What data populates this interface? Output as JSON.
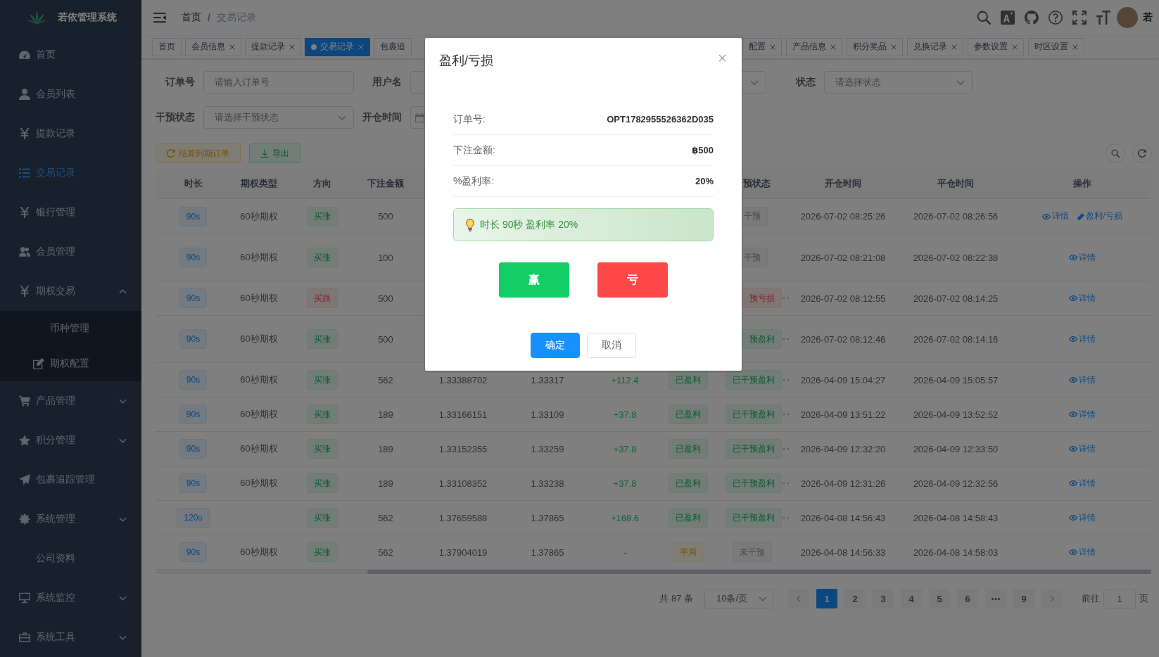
{
  "sidebar": {
    "title": "若依管理系统",
    "items": [
      {
        "label": "首页",
        "selected": false
      },
      {
        "label": "会员列表",
        "selected": false
      },
      {
        "label": "提款记录",
        "selected": false
      },
      {
        "label": "交易记录",
        "selected": true
      },
      {
        "label": "银行管理",
        "selected": false
      },
      {
        "label": "会员管理",
        "selected": false
      },
      {
        "label": "期权交易",
        "selected": false,
        "expanded": true,
        "children": [
          {
            "label": "币种管理",
            "selected": false
          },
          {
            "label": "期权配置",
            "selected": false
          }
        ]
      },
      {
        "label": "产品管理",
        "selected": false,
        "expanded": false
      },
      {
        "label": "积分管理",
        "selected": false,
        "expanded": false
      },
      {
        "label": "包裹追踪管理",
        "selected": false
      },
      {
        "label": "系统管理",
        "selected": false,
        "expanded": false
      },
      {
        "label": "公司资料",
        "selected": false
      },
      {
        "label": "系统监控",
        "selected": false,
        "expanded": false
      },
      {
        "label": "系统工具",
        "selected": false,
        "expanded": false
      }
    ]
  },
  "navbar": {
    "breadcrumb": {
      "items": [
        "首页",
        "交易记录"
      ],
      "separator": "/"
    },
    "user": "若"
  },
  "tabs": [
    {
      "label": "首页",
      "selected": false,
      "closable": false
    },
    {
      "label": "会员信息",
      "selected": false,
      "closable": true
    },
    {
      "label": "提款记录",
      "selected": false,
      "closable": true
    },
    {
      "label": "交易记录",
      "selected": true,
      "closable": true
    },
    {
      "label": "包裹追",
      "selected": false,
      "closable": false
    },
    {
      "label": "配置",
      "selected": false,
      "closable": true
    },
    {
      "label": "产品信息",
      "selected": false,
      "closable": true
    },
    {
      "label": "积分奖品",
      "selected": false,
      "closable": true
    },
    {
      "label": "兑换记录",
      "selected": false,
      "closable": true
    },
    {
      "label": "参数设置",
      "selected": false,
      "closable": true
    },
    {
      "label": "时区设置",
      "selected": false,
      "closable": true
    }
  ],
  "filters": [
    [
      {
        "label": "订单号",
        "kind": "input",
        "placeholder": "请输入订单号"
      },
      {
        "label": "用户名",
        "kind": "input"
      },
      {
        "kind": "select"
      },
      {
        "label": "状态",
        "kind": "select",
        "placeholder": "请选择状态"
      }
    ],
    [
      {
        "label": "干预状态",
        "kind": "select",
        "placeholder": "请选择干预状态"
      },
      {
        "label": "开仓时间",
        "kind": "date"
      }
    ]
  ],
  "toolbar": [
    {
      "label": "结算到期订单",
      "kind": "warning"
    },
    {
      "label": "导出",
      "kind": "success"
    }
  ],
  "table": {
    "header": {
      "duration": "时长",
      "option_type": "期权类型",
      "direction": "方向",
      "amount": "下注金额",
      "intervention": "预状态",
      "open_time": "开仓时间",
      "close_time": "平仓时间",
      "actions": "操作"
    },
    "rows": [
      {
        "duration": "90s",
        "option_type": "60秒期权",
        "direction": {
          "text": "买涨",
          "kind": "success"
        },
        "amount": "500",
        "intervention": {
          "text": "干预",
          "kind": "info",
          "truncated": false
        },
        "open_time": "2026-07-02 08:25:26",
        "close_time": "2026-07-02 08:26:56",
        "actions": [
          {
            "label": "详情",
            "kind": "view"
          },
          {
            "label": "盈利/亏损",
            "kind": "edit"
          }
        ]
      },
      {
        "duration": "90s",
        "option_type": "60秒期权",
        "direction": {
          "text": "买涨",
          "kind": "success"
        },
        "amount": "100",
        "intervention": {
          "text": "干预",
          "kind": "info",
          "truncated": false
        },
        "open_time": "2026-07-02 08:21:08",
        "close_time": "2026-07-02 08:22:38",
        "actions": [
          {
            "label": "详情",
            "kind": "view"
          }
        ]
      },
      {
        "duration": "90s",
        "option_type": "60秒期权",
        "direction": {
          "text": "买跌",
          "kind": "danger"
        },
        "amount": "500",
        "intervention": {
          "text": "预亏损",
          "kind": "danger",
          "truncated": true
        },
        "open_time": "2026-07-02 08:12:55",
        "close_time": "2026-07-02 08:14:25",
        "actions": [
          {
            "label": "详情",
            "kind": "view"
          }
        ]
      },
      {
        "duration": "90s",
        "option_type": "60秒期权",
        "direction": {
          "text": "买涨",
          "kind": "success"
        },
        "amount": "500",
        "intervention": {
          "text": "预盈利",
          "kind": "success",
          "truncated": true
        },
        "open_time": "2026-07-02 08:12:46",
        "close_time": "2026-07-02 08:14:16",
        "actions": [
          {
            "label": "详情",
            "kind": "view"
          }
        ]
      },
      {
        "duration": "90s",
        "option_type": "60秒期权",
        "direction": {
          "text": "买涨",
          "kind": "success"
        },
        "amount": "562",
        "column_5": "1.33388702",
        "column_6": "1.33317",
        "column_7": {
          "text": "+112.4",
          "kind": "gain"
        },
        "column_8": {
          "text": "已盈利",
          "kind": "success"
        },
        "intervention": {
          "text": "已干预盈利",
          "kind": "success",
          "truncated": true
        },
        "open_time": "2026-04-09 15:04:27",
        "close_time": "2026-04-09 15:05:57",
        "actions": [
          {
            "label": "详情",
            "kind": "view"
          }
        ]
      },
      {
        "duration": "90s",
        "option_type": "60秒期权",
        "direction": {
          "text": "买涨",
          "kind": "success"
        },
        "amount": "189",
        "column_5": "1.33166151",
        "column_6": "1.33109",
        "column_7": {
          "text": "+37.8",
          "kind": "gain"
        },
        "column_8": {
          "text": "已盈利",
          "kind": "success"
        },
        "intervention": {
          "text": "已干预盈利",
          "kind": "success",
          "truncated": true
        },
        "open_time": "2026-04-09 13:51:22",
        "close_time": "2026-04-09 13:52:52",
        "actions": [
          {
            "label": "详情",
            "kind": "view"
          }
        ]
      },
      {
        "duration": "90s",
        "option_type": "60秒期权",
        "direction": {
          "text": "买涨",
          "kind": "success"
        },
        "amount": "189",
        "column_5": "1.33152355",
        "column_6": "1.33259",
        "column_7": {
          "text": "+37.8",
          "kind": "gain"
        },
        "column_8": {
          "text": "已盈利",
          "kind": "success"
        },
        "intervention": {
          "text": "已干预盈利",
          "kind": "success",
          "truncated": true
        },
        "open_time": "2026-04-09 12:32:20",
        "close_time": "2026-04-09 12:33:50",
        "actions": [
          {
            "label": "详情",
            "kind": "view"
          }
        ]
      },
      {
        "duration": "90s",
        "option_type": "60秒期权",
        "direction": {
          "text": "买涨",
          "kind": "success"
        },
        "amount": "189",
        "column_5": "1.33108352",
        "column_6": "1.33238",
        "column_7": {
          "text": "+37.8",
          "kind": "gain"
        },
        "column_8": {
          "text": "已盈利",
          "kind": "success"
        },
        "intervention": {
          "text": "已干预盈利",
          "kind": "success",
          "truncated": true
        },
        "open_time": "2026-04-09 12:31:26",
        "close_time": "2026-04-09 12:32:56",
        "actions": [
          {
            "label": "详情",
            "kind": "view"
          }
        ]
      },
      {
        "duration": "120s",
        "direction": {
          "text": "买涨",
          "kind": "success"
        },
        "amount": "562",
        "column_5": "1.37659588",
        "column_6": "1.37865",
        "column_7": {
          "text": "+168.6",
          "kind": "gain"
        },
        "column_8": {
          "text": "已盈利",
          "kind": "success"
        },
        "intervention": {
          "text": "已干预盈利",
          "kind": "success",
          "truncated": true
        },
        "open_time": "2026-04-08 14:56:43",
        "close_time": "2026-04-08 14:58:43",
        "actions": [
          {
            "label": "详情",
            "kind": "view"
          }
        ]
      },
      {
        "duration": "90s",
        "option_type": "60秒期权",
        "direction": {
          "text": "买涨",
          "kind": "success"
        },
        "amount": "562",
        "column_5": "1.37904019",
        "column_6": "1.37865",
        "column_7": {
          "text": "-",
          "kind": "plain"
        },
        "column_8": {
          "text": "平局",
          "kind": "warning"
        },
        "intervention": {
          "text": "未干预",
          "kind": "info",
          "truncated": false
        },
        "open_time": "2026-04-08 14:56:33",
        "close_time": "2026-04-08 14:58:03",
        "actions": [
          {
            "label": "详情",
            "kind": "view"
          }
        ]
      }
    ]
  },
  "pagination": {
    "total": "共 87 条",
    "page_size": "10条/页",
    "pages": [
      {
        "kind": "page",
        "label": "1",
        "selected": true
      },
      {
        "kind": "page",
        "label": "2",
        "selected": false
      },
      {
        "kind": "page",
        "label": "3",
        "selected": false
      },
      {
        "kind": "page",
        "label": "4",
        "selected": false
      },
      {
        "kind": "page",
        "label": "5",
        "selected": false
      },
      {
        "kind": "page",
        "label": "6",
        "selected": false
      },
      {
        "kind": "more"
      },
      {
        "kind": "page",
        "label": "9",
        "selected": false
      }
    ],
    "goto_label": "前往",
    "goto_value": "1",
    "goto_unit": "页"
  },
  "dialog": {
    "title": "盈利/亏损",
    "fields": [
      {
        "label": "订单号:",
        "value": "OPT1782955526362D035"
      },
      {
        "label": "下注金额:",
        "value": "฿500"
      },
      {
        "label": "%盈利率:",
        "value": "20%"
      }
    ],
    "hint": "时长 90秒 盈利率 20%",
    "choices": [
      {
        "label": "赢",
        "kind": "win"
      },
      {
        "label": "亏",
        "kind": "lose"
      }
    ],
    "buttons": [
      {
        "label": "确定",
        "kind": "primary"
      },
      {
        "label": "取消",
        "kind": "default"
      }
    ]
  }
}
